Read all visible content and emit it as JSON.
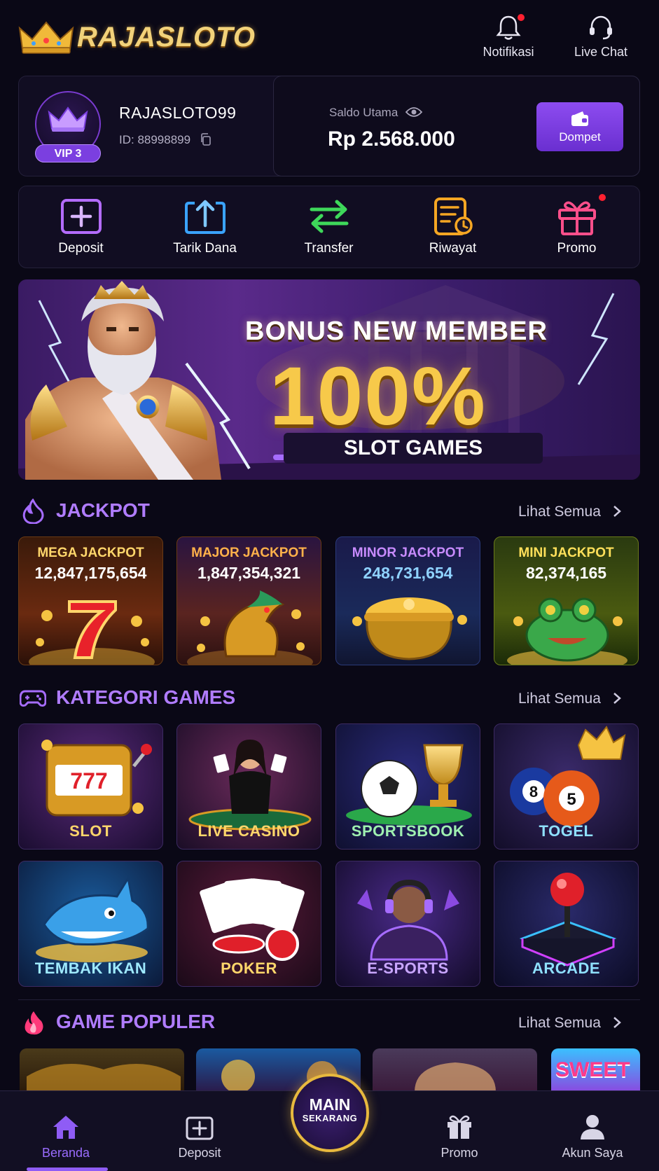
{
  "header": {
    "logo_text": "RAJASLOTO",
    "notifications_label": "Notifikasi",
    "live_chat_label": "Live Chat"
  },
  "profile": {
    "username": "RAJASLOTO99",
    "user_id": "ID: 88998899",
    "vip_badge": "VIP 3"
  },
  "balance": {
    "label": "Saldo Utama",
    "value": "Rp 2.568.000",
    "wallet_label": "Dompet"
  },
  "actions": [
    {
      "label": "Deposit",
      "icon": "deposit-icon",
      "color": "#b46cff"
    },
    {
      "label": "Tarik Dana",
      "icon": "withdraw-icon",
      "color": "#3aa3ff"
    },
    {
      "label": "Transfer",
      "icon": "transfer-icon",
      "color": "#3ed85a"
    },
    {
      "label": "Riwayat",
      "icon": "history-icon",
      "color": "#f5a623"
    },
    {
      "label": "Promo",
      "icon": "gift-icon",
      "color": "#ff4f8b"
    }
  ],
  "banner": {
    "line1": "BONUS NEW MEMBER",
    "line2": "100%",
    "line3": "SLOT GAMES"
  },
  "jackpot": {
    "title": "JACKPOT",
    "see_all": "Lihat Semua",
    "items": [
      {
        "name": "MEGA JACKPOT",
        "value": "12,847,175,654",
        "name_color": "#ffd66b",
        "value_color": "#ffffff"
      },
      {
        "name": "MAJOR JACKPOT",
        "value": "1,847,354,321",
        "name_color": "#ffb14a",
        "value_color": "#ffffff"
      },
      {
        "name": "MINOR JACKPOT",
        "value": "248,731,654",
        "name_color": "#c88bff",
        "value_color": "#8fd2ff"
      },
      {
        "name": "MINI JACKPOT",
        "value": "82,374,165",
        "name_color": "#ffe05a",
        "value_color": "#ffffff"
      }
    ]
  },
  "categories": {
    "title": "KATEGORI GAMES",
    "see_all": "Lihat Semua",
    "items": [
      "SLOT",
      "LIVE CASINO",
      "SPORTSBOOK",
      "TOGEL",
      "TEMBAK IKAN",
      "POKER",
      "E-SPORTS",
      "ARCADE"
    ]
  },
  "popular": {
    "title": "GAME POPULER",
    "see_all": "Lihat Semua",
    "partial_card_text": "SWEET"
  },
  "nav": {
    "home": "Beranda",
    "deposit": "Deposit",
    "main_line1": "MAIN",
    "main_line2": "SEKARANG",
    "promo": "Promo",
    "account": "Akun Saya"
  },
  "colors": {
    "accent": "#8b4cf0",
    "gold": "#f2c94a",
    "background": "#0a0816"
  }
}
